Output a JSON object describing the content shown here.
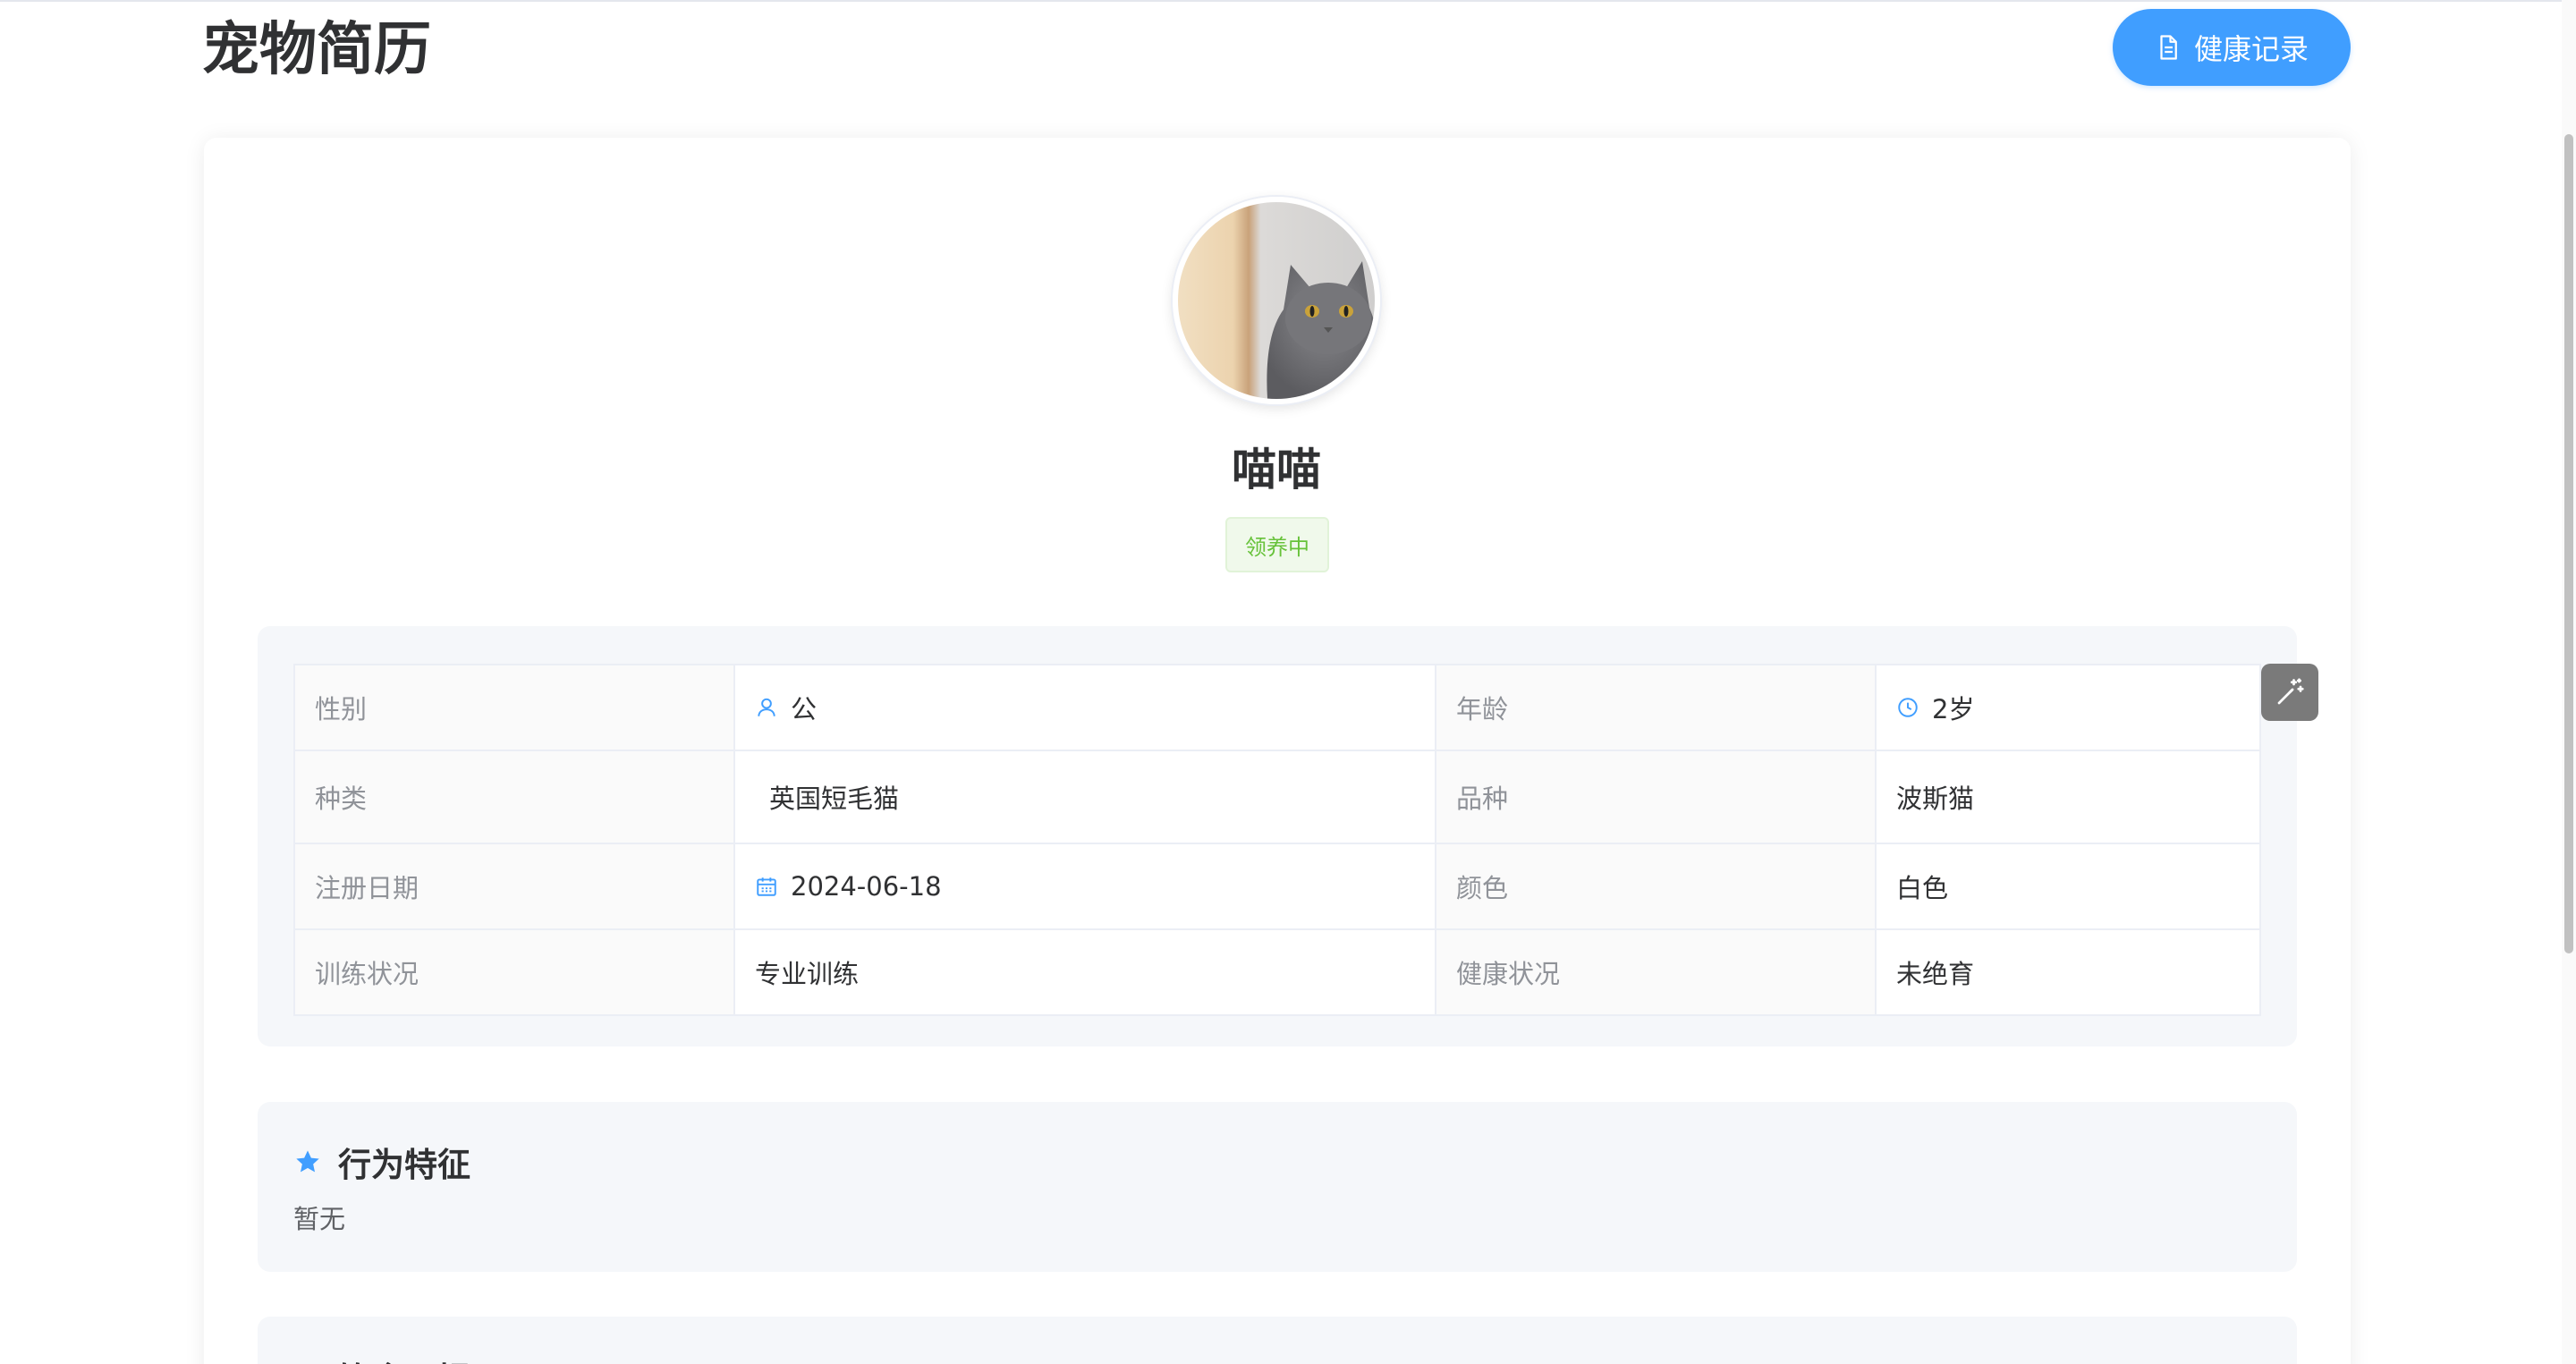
{
  "page": {
    "title": "宠物简历",
    "health_button_label": "健康记录"
  },
  "pet": {
    "name": "喵喵",
    "status": "领养中"
  },
  "info": {
    "rows": [
      {
        "label1": "性别",
        "value1": "公",
        "label2": "年龄",
        "value2": "2岁"
      },
      {
        "label1": "种类",
        "value1": "英国短毛猫",
        "label2": "品种",
        "value2": "波斯猫"
      },
      {
        "label1": "注册日期",
        "value1": "2024-06-18",
        "label2": "颜色",
        "value2": "白色"
      },
      {
        "label1": "训练状况",
        "value1": "专业训练",
        "label2": "健康状况",
        "value2": "未绝育"
      }
    ]
  },
  "behavior": {
    "title": "行为特征",
    "text": "暂无"
  },
  "next_section": {
    "title": "饮食习惯"
  },
  "colors": {
    "primary": "#409eff",
    "success": "#67c23a",
    "section_bg": "#f5f7fa"
  },
  "icons": {
    "health_button": "document-icon",
    "gender": "user-icon",
    "age": "clock-icon",
    "date": "calendar-icon",
    "magic": "magic-wand-icon",
    "behavior": "star-icon",
    "next_section": "circle-icon"
  }
}
